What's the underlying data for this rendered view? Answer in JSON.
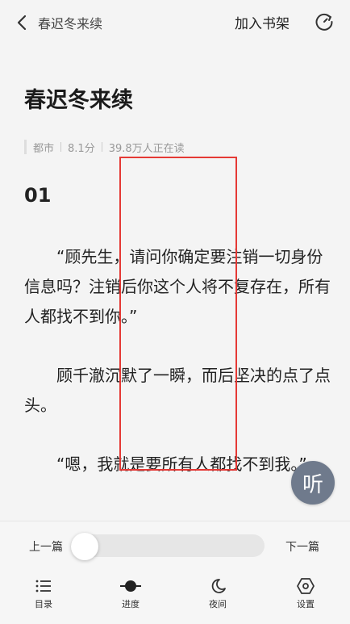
{
  "header": {
    "title": "春迟冬来续",
    "add_shelf_label": "加入书架"
  },
  "book": {
    "title": "春迟冬来续",
    "genre": "都市",
    "score": "8.1分",
    "readers": "39.8万人正在读"
  },
  "chapter": {
    "number": "01",
    "paragraphs": [
      "“顾先生，请问你确定要注销一切身份信息吗？注销后你这个人将不复存在，所有人都找不到你。”",
      "顾千澈沉默了一瞬，而后坚决的点了点头。",
      "“嗯，我就是要所有人都找不到我。”"
    ]
  },
  "listen_label": "听",
  "progress": {
    "prev_label": "上一篇",
    "next_label": "下一篇",
    "value": 0
  },
  "toolbar": {
    "items": [
      {
        "label": "目录",
        "icon": "list-icon"
      },
      {
        "label": "进度",
        "icon": "progress-icon"
      },
      {
        "label": "夜间",
        "icon": "moon-icon"
      },
      {
        "label": "设置",
        "icon": "settings-icon"
      }
    ]
  },
  "colors": {
    "highlight_box": "#e53935",
    "listen_button": "#6f7a8c"
  }
}
